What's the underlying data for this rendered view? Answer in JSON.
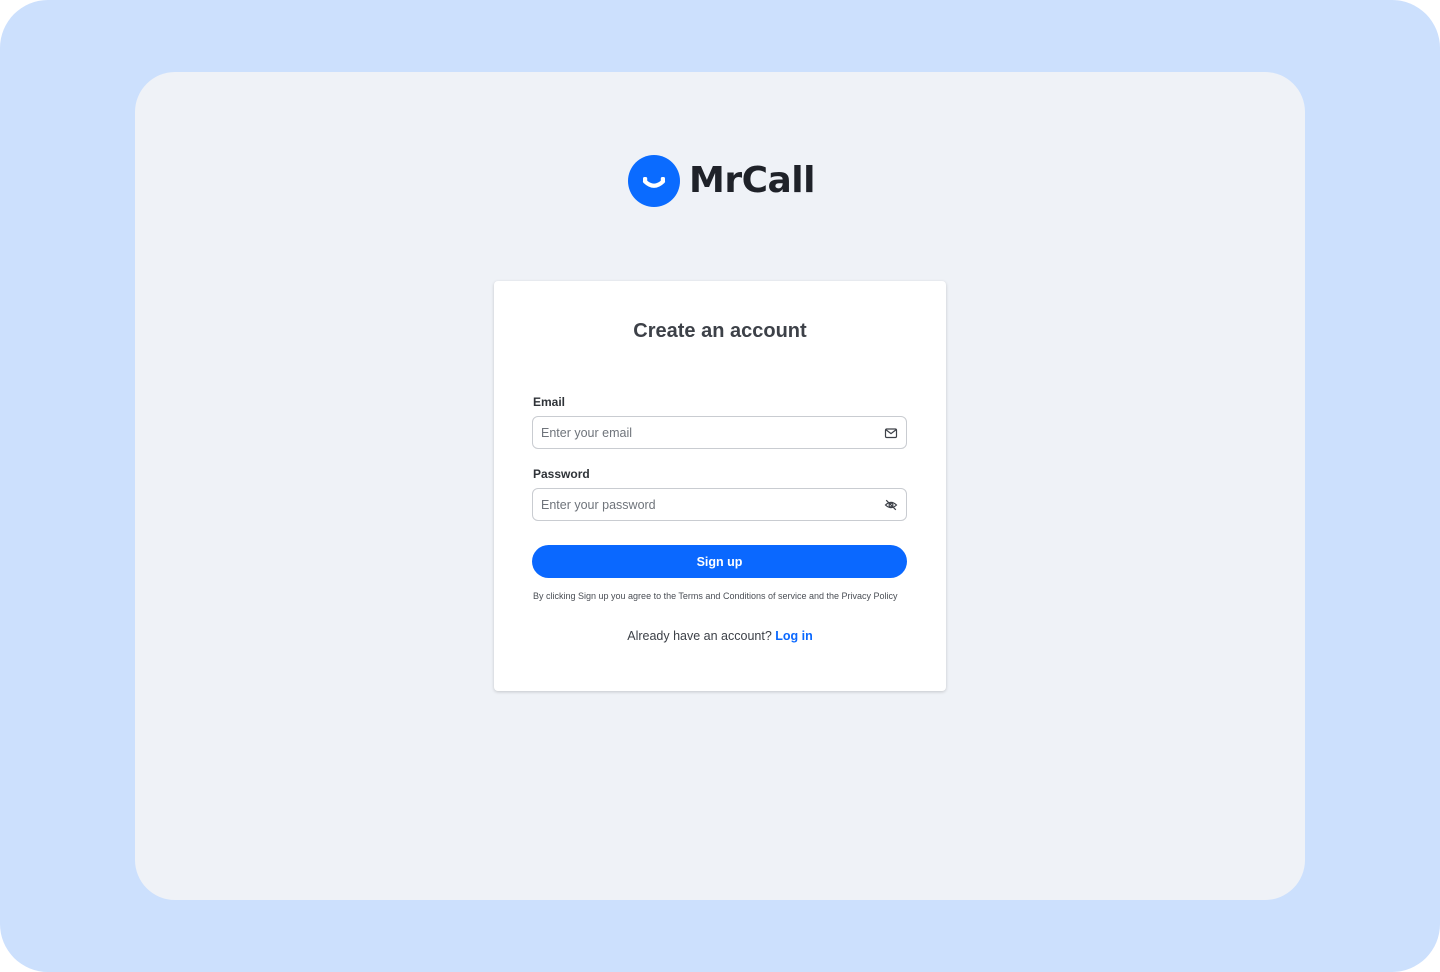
{
  "brand": {
    "name": "MrCall",
    "logo_color": "#0a6bff"
  },
  "form": {
    "title": "Create an account",
    "email": {
      "label": "Email",
      "placeholder": "Enter your email",
      "icon": "mail-icon"
    },
    "password": {
      "label": "Password",
      "placeholder": "Enter your password",
      "icon": "eye-off-icon"
    },
    "submit_label": "Sign up",
    "terms_text": "By clicking Sign up you agree to the Terms and Conditions of service and the Privacy Policy",
    "login_prompt": "Already have an account?",
    "login_link": "Log in"
  },
  "colors": {
    "accent": "#0a68ff",
    "outer_background": "#cce0fd",
    "panel_background": "#eff2f7"
  }
}
